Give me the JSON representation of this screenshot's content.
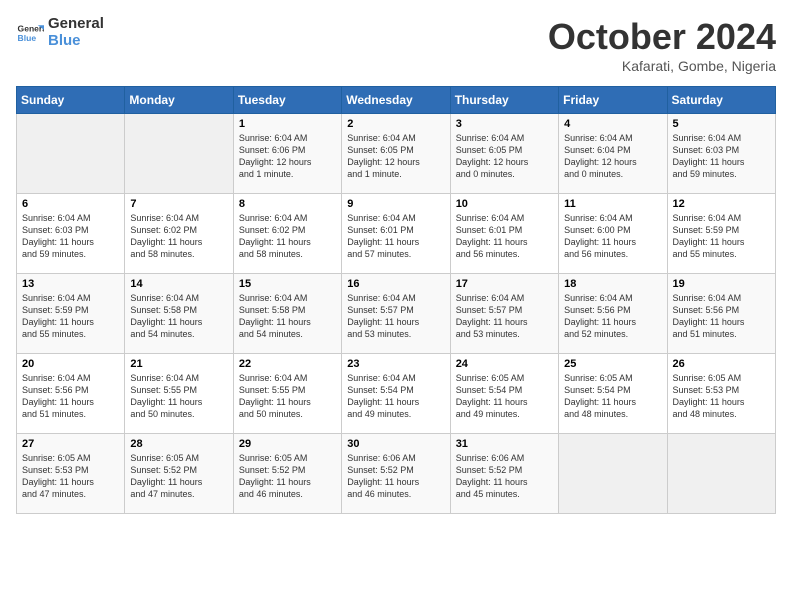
{
  "logo": {
    "line1": "General",
    "line2": "Blue"
  },
  "title": "October 2024",
  "location": "Kafarati, Gombe, Nigeria",
  "weekdays": [
    "Sunday",
    "Monday",
    "Tuesday",
    "Wednesday",
    "Thursday",
    "Friday",
    "Saturday"
  ],
  "weeks": [
    [
      {
        "day": "",
        "info": ""
      },
      {
        "day": "",
        "info": ""
      },
      {
        "day": "1",
        "info": "Sunrise: 6:04 AM\nSunset: 6:06 PM\nDaylight: 12 hours\nand 1 minute."
      },
      {
        "day": "2",
        "info": "Sunrise: 6:04 AM\nSunset: 6:05 PM\nDaylight: 12 hours\nand 1 minute."
      },
      {
        "day": "3",
        "info": "Sunrise: 6:04 AM\nSunset: 6:05 PM\nDaylight: 12 hours\nand 0 minutes."
      },
      {
        "day": "4",
        "info": "Sunrise: 6:04 AM\nSunset: 6:04 PM\nDaylight: 12 hours\nand 0 minutes."
      },
      {
        "day": "5",
        "info": "Sunrise: 6:04 AM\nSunset: 6:03 PM\nDaylight: 11 hours\nand 59 minutes."
      }
    ],
    [
      {
        "day": "6",
        "info": "Sunrise: 6:04 AM\nSunset: 6:03 PM\nDaylight: 11 hours\nand 59 minutes."
      },
      {
        "day": "7",
        "info": "Sunrise: 6:04 AM\nSunset: 6:02 PM\nDaylight: 11 hours\nand 58 minutes."
      },
      {
        "day": "8",
        "info": "Sunrise: 6:04 AM\nSunset: 6:02 PM\nDaylight: 11 hours\nand 58 minutes."
      },
      {
        "day": "9",
        "info": "Sunrise: 6:04 AM\nSunset: 6:01 PM\nDaylight: 11 hours\nand 57 minutes."
      },
      {
        "day": "10",
        "info": "Sunrise: 6:04 AM\nSunset: 6:01 PM\nDaylight: 11 hours\nand 56 minutes."
      },
      {
        "day": "11",
        "info": "Sunrise: 6:04 AM\nSunset: 6:00 PM\nDaylight: 11 hours\nand 56 minutes."
      },
      {
        "day": "12",
        "info": "Sunrise: 6:04 AM\nSunset: 5:59 PM\nDaylight: 11 hours\nand 55 minutes."
      }
    ],
    [
      {
        "day": "13",
        "info": "Sunrise: 6:04 AM\nSunset: 5:59 PM\nDaylight: 11 hours\nand 55 minutes."
      },
      {
        "day": "14",
        "info": "Sunrise: 6:04 AM\nSunset: 5:58 PM\nDaylight: 11 hours\nand 54 minutes."
      },
      {
        "day": "15",
        "info": "Sunrise: 6:04 AM\nSunset: 5:58 PM\nDaylight: 11 hours\nand 54 minutes."
      },
      {
        "day": "16",
        "info": "Sunrise: 6:04 AM\nSunset: 5:57 PM\nDaylight: 11 hours\nand 53 minutes."
      },
      {
        "day": "17",
        "info": "Sunrise: 6:04 AM\nSunset: 5:57 PM\nDaylight: 11 hours\nand 53 minutes."
      },
      {
        "day": "18",
        "info": "Sunrise: 6:04 AM\nSunset: 5:56 PM\nDaylight: 11 hours\nand 52 minutes."
      },
      {
        "day": "19",
        "info": "Sunrise: 6:04 AM\nSunset: 5:56 PM\nDaylight: 11 hours\nand 51 minutes."
      }
    ],
    [
      {
        "day": "20",
        "info": "Sunrise: 6:04 AM\nSunset: 5:56 PM\nDaylight: 11 hours\nand 51 minutes."
      },
      {
        "day": "21",
        "info": "Sunrise: 6:04 AM\nSunset: 5:55 PM\nDaylight: 11 hours\nand 50 minutes."
      },
      {
        "day": "22",
        "info": "Sunrise: 6:04 AM\nSunset: 5:55 PM\nDaylight: 11 hours\nand 50 minutes."
      },
      {
        "day": "23",
        "info": "Sunrise: 6:04 AM\nSunset: 5:54 PM\nDaylight: 11 hours\nand 49 minutes."
      },
      {
        "day": "24",
        "info": "Sunrise: 6:05 AM\nSunset: 5:54 PM\nDaylight: 11 hours\nand 49 minutes."
      },
      {
        "day": "25",
        "info": "Sunrise: 6:05 AM\nSunset: 5:54 PM\nDaylight: 11 hours\nand 48 minutes."
      },
      {
        "day": "26",
        "info": "Sunrise: 6:05 AM\nSunset: 5:53 PM\nDaylight: 11 hours\nand 48 minutes."
      }
    ],
    [
      {
        "day": "27",
        "info": "Sunrise: 6:05 AM\nSunset: 5:53 PM\nDaylight: 11 hours\nand 47 minutes."
      },
      {
        "day": "28",
        "info": "Sunrise: 6:05 AM\nSunset: 5:52 PM\nDaylight: 11 hours\nand 47 minutes."
      },
      {
        "day": "29",
        "info": "Sunrise: 6:05 AM\nSunset: 5:52 PM\nDaylight: 11 hours\nand 46 minutes."
      },
      {
        "day": "30",
        "info": "Sunrise: 6:06 AM\nSunset: 5:52 PM\nDaylight: 11 hours\nand 46 minutes."
      },
      {
        "day": "31",
        "info": "Sunrise: 6:06 AM\nSunset: 5:52 PM\nDaylight: 11 hours\nand 45 minutes."
      },
      {
        "day": "",
        "info": ""
      },
      {
        "day": "",
        "info": ""
      }
    ]
  ]
}
